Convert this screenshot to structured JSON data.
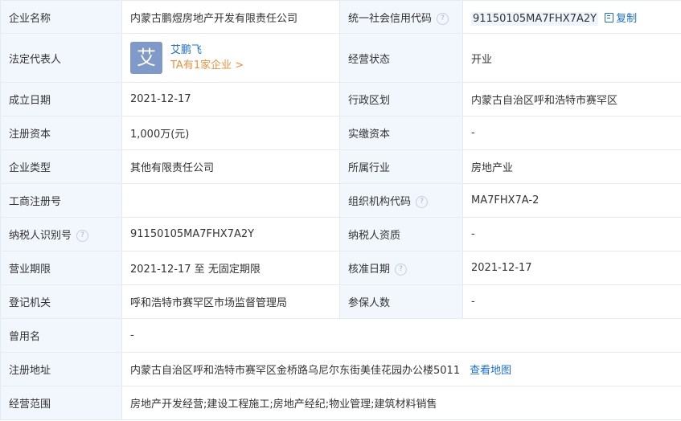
{
  "company_name": {
    "label": "企业名称",
    "value": "内蒙古鹏煜房地产开发有限责任公司"
  },
  "credit_code": {
    "label": "统一社会信用代码",
    "value": "91150105MA7FHX7A2Y",
    "copy_label": "复制"
  },
  "legal_rep": {
    "label": "法定代表人",
    "avatar_char": "艾",
    "name": "艾鹏飞",
    "more": "TA有1家企业 >"
  },
  "status": {
    "label": "经营状态",
    "value": "开业"
  },
  "established": {
    "label": "成立日期",
    "value": "2021-12-17"
  },
  "region": {
    "label": "行政区划",
    "value": "内蒙古自治区呼和浩特市赛罕区"
  },
  "reg_capital": {
    "label": "注册资本",
    "value": "1,000万(元)"
  },
  "paid_capital": {
    "label": "实缴资本",
    "value": "-"
  },
  "company_type": {
    "label": "企业类型",
    "value": "其他有限责任公司"
  },
  "industry": {
    "label": "所属行业",
    "value": "房地产业"
  },
  "biz_reg_no": {
    "label": "工商注册号",
    "value": ""
  },
  "org_code": {
    "label": "组织机构代码",
    "value": "MA7FHX7A-2"
  },
  "tax_id": {
    "label": "纳税人识别号",
    "value": "91150105MA7FHX7A2Y"
  },
  "tax_qual": {
    "label": "纳税人资质",
    "value": "-"
  },
  "biz_term": {
    "label": "营业期限",
    "value": "2021-12-17 至 无固定期限"
  },
  "approval_date": {
    "label": "核准日期",
    "value": "2021-12-17"
  },
  "reg_authority": {
    "label": "登记机关",
    "value": "呼和浩特市赛罕区市场监督管理局"
  },
  "insured": {
    "label": "参保人数",
    "value": "-"
  },
  "former_name": {
    "label": "曾用名",
    "value": "-"
  },
  "reg_address": {
    "label": "注册地址",
    "value": "内蒙古自治区呼和浩特市赛罕区金桥路乌尼尔东街美佳花园办公楼5011",
    "map_label": "查看地图"
  },
  "biz_scope": {
    "label": "经营范围",
    "value": "房地产开发经营;建设工程施工;房地产经纪;物业管理;建筑材料销售"
  },
  "help_icon_glyph": "?",
  "colors": {
    "label_bg": "#f2f7fd",
    "border": "#e4eaf2",
    "link": "#1a6fd6",
    "accent_orange": "#f08f3c",
    "avatar_bg": "#7f9ac9"
  }
}
